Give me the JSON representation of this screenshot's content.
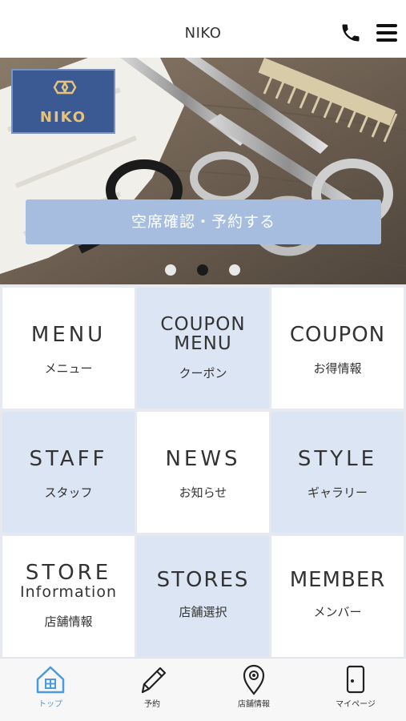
{
  "header": {
    "title": "NIKO"
  },
  "hero": {
    "logo_text": "NIKO",
    "reserve_label": "空席確認・予約する",
    "carousel_active_index": 1,
    "carousel_count": 3
  },
  "menu": [
    {
      "en": "MENU",
      "jp": "メニュー"
    },
    {
      "en": "COUPON",
      "en2": "MENU",
      "jp": "クーポン"
    },
    {
      "en": "COUPON",
      "jp": "お得情報"
    },
    {
      "en": "STAFF",
      "jp": "スタッフ"
    },
    {
      "en": "NEWS",
      "jp": "お知らせ"
    },
    {
      "en": "STYLE",
      "jp": "ギャラリー"
    },
    {
      "en": "STORE",
      "en2": "Information",
      "jp": "店舗情報"
    },
    {
      "en": "STORES",
      "jp": "店舗選択"
    },
    {
      "en": "MEMBER",
      "jp": "メンバー"
    }
  ],
  "tabbar": {
    "items": [
      {
        "label": "トップ",
        "icon": "home-icon",
        "active": true
      },
      {
        "label": "予約",
        "icon": "pencil-icon",
        "active": false
      },
      {
        "label": "店舗情報",
        "icon": "map-pin-icon",
        "active": false
      },
      {
        "label": "マイページ",
        "icon": "card-icon",
        "active": false
      }
    ]
  },
  "colors": {
    "accent_blue": "#a6bde0",
    "tile_blue": "#dbe5f3",
    "logo_bg": "#3b5a94",
    "logo_gold": "#e7c37a",
    "active_tab": "#4a9ae0"
  }
}
